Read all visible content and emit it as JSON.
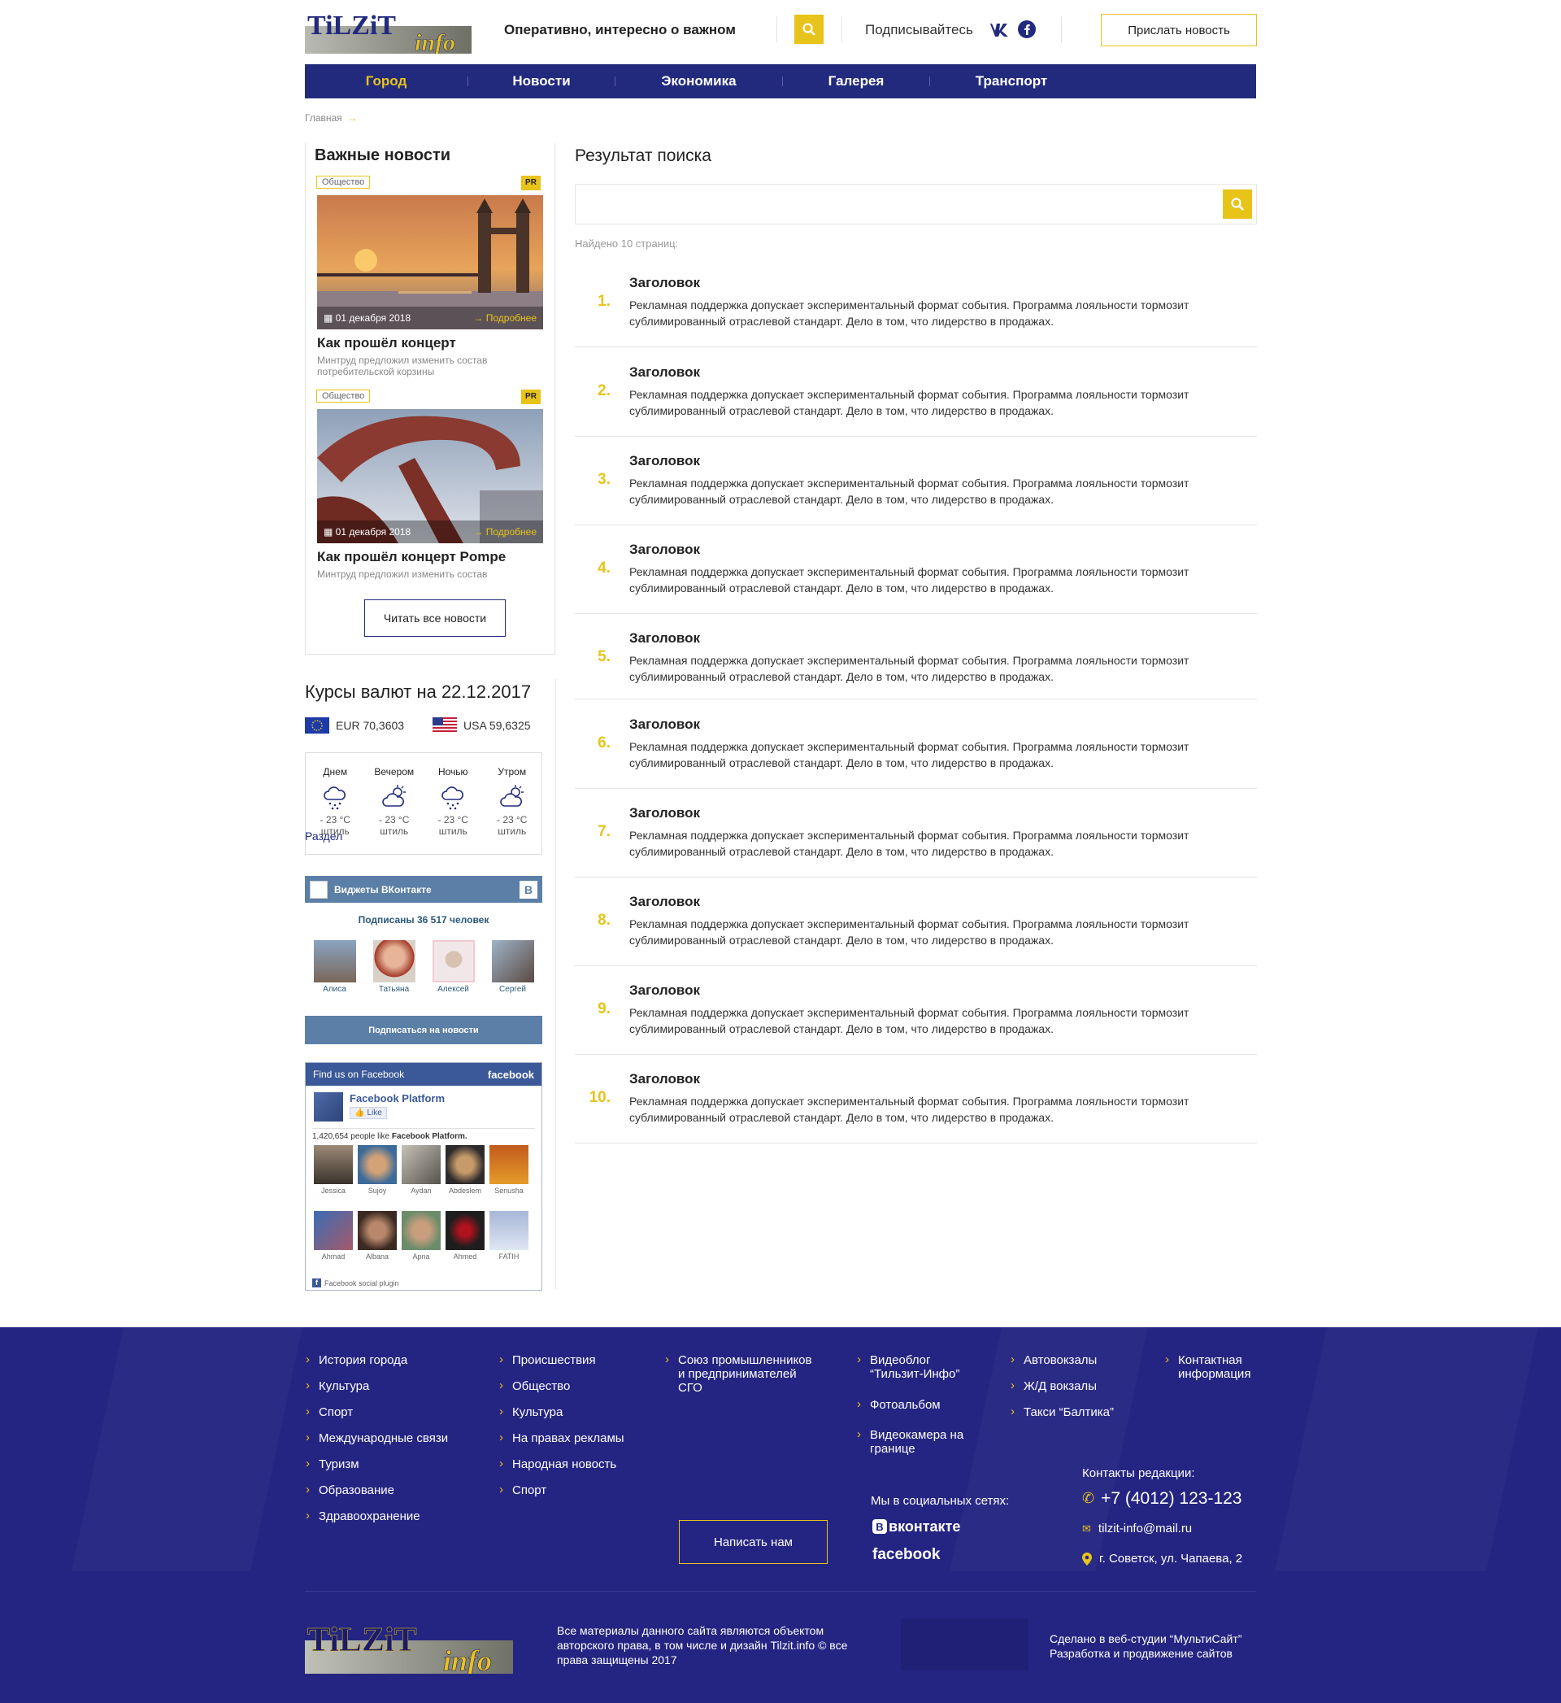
{
  "header": {
    "logo_main": "TiLZiT",
    "logo_sub": "info",
    "tagline": "Оперативно, интересно о важном",
    "subscribe_label": "Подписывайтесь",
    "send_news_button": "Прислать новость"
  },
  "nav": {
    "items": [
      {
        "label": "Город",
        "active": true
      },
      {
        "label": "Новости",
        "active": false
      },
      {
        "label": "Экономика",
        "active": false
      },
      {
        "label": "Галерея",
        "active": false
      },
      {
        "label": "Транспорт",
        "active": false
      }
    ]
  },
  "breadcrumb": {
    "home": "Главная",
    "arrow": "→",
    "current": "Раздел"
  },
  "important_news": {
    "title": "Важные новости",
    "items": [
      {
        "tag": "Общество",
        "badge": "PR",
        "date": "01 декабря 2018",
        "more": "→ Подробнее",
        "title": "Как прошёл концерт",
        "desc": "Минтруд предложил изменить состав потребительской корзины"
      },
      {
        "tag": "Общество",
        "badge": "PR",
        "date": "01 декабря 2018",
        "more": "→ Подробнее",
        "title": "Как прошёл концерт Pompe",
        "desc": "Минтруд предложил изменить состав"
      }
    ],
    "read_all_button": "Читать все новости"
  },
  "currency": {
    "title": "Курсы валют на 22.12.2017",
    "eur": "EUR 70,3603",
    "usd": "USA 59,6325"
  },
  "weather": {
    "items": [
      {
        "period": "Днем",
        "icon": "snow-cloud-icon",
        "temp": "- 23 °C",
        "wind": "штиль"
      },
      {
        "period": "Вечером",
        "icon": "sun-cloud-icon",
        "temp": "- 23 °C",
        "wind": "штиль"
      },
      {
        "period": "Ночью",
        "icon": "snow-cloud-icon",
        "temp": "- 23 °C",
        "wind": "штиль"
      },
      {
        "period": "Утром",
        "icon": "sun-cloud-icon",
        "temp": "- 23 °C",
        "wind": "штиль"
      }
    ]
  },
  "vk_widget": {
    "title": "Виджеты ВКонтакте",
    "count": "Подписаны 36 517 человек",
    "people": [
      "Алиса",
      "Татьяна",
      "Алексей",
      "Сергей"
    ],
    "subscribe_button": "Подписаться на новости"
  },
  "fb_widget": {
    "header": "Find us on Facebook",
    "brand": "facebook",
    "page_name": "Facebook Platform",
    "like_label": "Like",
    "likes_text": "1,420,654 people like",
    "likes_page": "Facebook Platform.",
    "people": [
      "Jessica",
      "Sujoy",
      "Aydan",
      "Abdeslem",
      "Senusha",
      "Ahmad",
      "Albana",
      "Apna",
      "Ahmed",
      "FATIH"
    ],
    "plugin_label": "Facebook social plugin"
  },
  "search": {
    "title": "Результат поиска",
    "placeholder": "",
    "found_text": "Найдено 10 страниц:",
    "results": [
      {
        "num": "1.",
        "title": "Заголовок",
        "desc": "Рекламная поддержка допускает экспериментальный формат события. Программа лояльности тормозит сублимированный отраслевой стандарт. Дело в том, что лидерство в продажах."
      },
      {
        "num": "2.",
        "title": "Заголовок",
        "desc": "Рекламная поддержка допускает экспериментальный формат события. Программа лояльности тормозит сублимированный отраслевой стандарт. Дело в том, что лидерство в продажах."
      },
      {
        "num": "3.",
        "title": "Заголовок",
        "desc": "Рекламная поддержка допускает экспериментальный формат события. Программа лояльности тормозит сублимированный отраслевой стандарт. Дело в том, что лидерство в продажах."
      },
      {
        "num": "4.",
        "title": "Заголовок",
        "desc": "Рекламная поддержка допускает экспериментальный формат события. Программа лояльности тормозит сублимированный отраслевой стандарт. Дело в том, что лидерство в продажах."
      },
      {
        "num": "5.",
        "title": "Заголовок",
        "desc": "Рекламная поддержка допускает экспериментальный формат события. Программа лояльности тормозит сублимированный отраслевой стандарт. Дело в том, что лидерство в продажах."
      },
      {
        "num": "6.",
        "title": "Заголовок",
        "desc": "Рекламная поддержка допускает экспериментальный формат события. Программа лояльности тормозит сублимированный отраслевой стандарт. Дело в том, что лидерство в продажах."
      },
      {
        "num": "7.",
        "title": "Заголовок",
        "desc": "Рекламная поддержка допускает экспериментальный формат события. Программа лояльности тормозит сублимированный отраслевой стандарт. Дело в том, что лидерство в продажах."
      },
      {
        "num": "8.",
        "title": "Заголовок",
        "desc": "Рекламная поддержка допускает экспериментальный формат события. Программа лояльности тормозит сублимированный отраслевой стандарт. Дело в том, что лидерство в продажах."
      },
      {
        "num": "9.",
        "title": "Заголовок",
        "desc": "Рекламная поддержка допускает экспериментальный формат события. Программа лояльности тормозит сублимированный отраслевой стандарт. Дело в том, что лидерство в продажах."
      },
      {
        "num": "10.",
        "title": "Заголовок",
        "desc": "Рекламная поддержка допускает экспериментальный формат события. Программа лояльности тормозит сублимированный отраслевой стандарт. Дело в том, что лидерство в продажах."
      }
    ]
  },
  "footer": {
    "col1": [
      "История города",
      "Культура",
      "Спорт",
      "Международные связи",
      "Туризм",
      "Образование",
      "Здравоохранение"
    ],
    "col2": [
      "Происшествия",
      "Общество",
      "Культура",
      "На правах рекламы",
      "Народная новость",
      "Спорт"
    ],
    "col3": "Союз промышленников и предпринимателей СГО",
    "col4": [
      "Видеоблог “Тильзит-Инфо”",
      "Фотоальбом",
      "Видеокамера на границе"
    ],
    "col5": [
      "Автовокзалы",
      "Ж/Д вокзалы",
      "Такси “Балтика”"
    ],
    "col6": "Контактная информация",
    "write_us_button": "Написать нам",
    "social_title": "Мы в социальных сетях:",
    "vk_label": "вконтакте",
    "fb_label": "facebook",
    "contacts_title": "Контакты редакции:",
    "phone": "+7 (4012) 123-123",
    "email": "tilzit-info@mail.ru",
    "address": "г. Советск, ул. Чапаева, 2",
    "copyright": "Все материалы данного сайта являются объектом авторского права, в том числе и дизайн Tilzit.info © все права защищены 2017",
    "studio_line1": "Сделано в веб-студии “МультиСайт”",
    "studio_line2": "Разработка и продвижение сайтов"
  },
  "colors": {
    "accent": "#e8c31a",
    "brand": "#222a7e",
    "footer": "#242582"
  }
}
